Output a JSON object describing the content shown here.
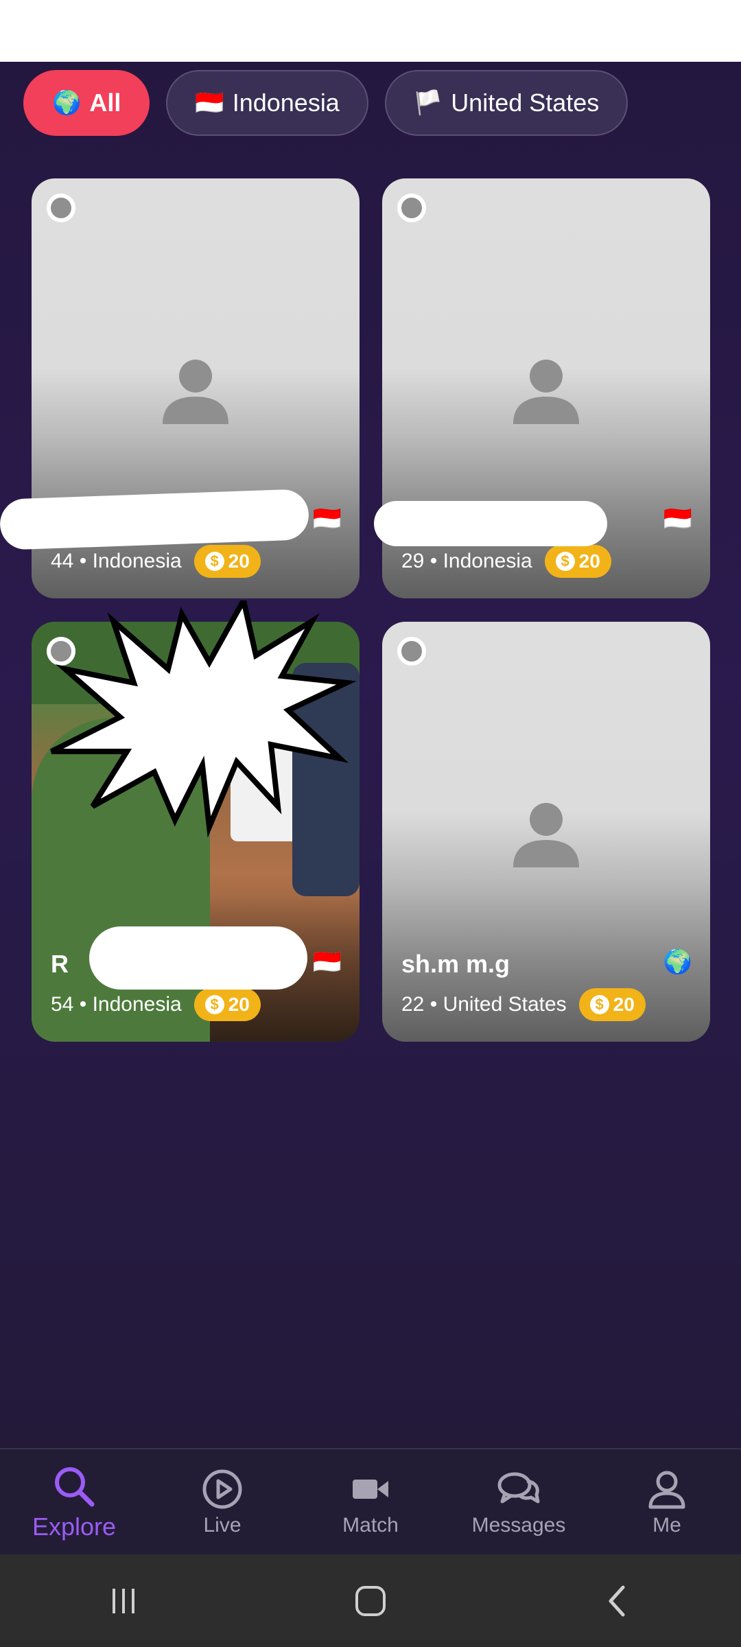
{
  "filters": [
    {
      "icon": "🌍",
      "label": "All",
      "active": true
    },
    {
      "icon": "🇮🇩",
      "label": "Indonesia",
      "active": false
    },
    {
      "icon": "🏳️",
      "label": "United States",
      "active": false
    }
  ],
  "cards": [
    {
      "name": "",
      "flag": "🇮🇩",
      "age": "44",
      "country": "Indonesia",
      "coins": "20"
    },
    {
      "name": "",
      "flag": "🇮🇩",
      "age": "29",
      "country": "Indonesia",
      "coins": "20"
    },
    {
      "name": "R",
      "flag": "🇮🇩",
      "age": "54",
      "country": "Indonesia",
      "coins": "20"
    },
    {
      "name": "sh.m m.g",
      "flag": "🌍",
      "age": "22",
      "country": "United States",
      "coins": "20"
    }
  ],
  "nav": [
    {
      "label": "Explore",
      "icon": "search-icon",
      "active": true
    },
    {
      "label": "Live",
      "icon": "play-icon",
      "active": false
    },
    {
      "label": "Match",
      "icon": "video-camera-icon",
      "active": false
    },
    {
      "label": "Messages",
      "icon": "chat-bubbles-icon",
      "active": false
    },
    {
      "label": "Me",
      "icon": "user-icon",
      "active": false
    }
  ],
  "colors": {
    "accent": "#f23f5a",
    "nav_active": "#9b5cf5",
    "coin": "#f2b319"
  }
}
